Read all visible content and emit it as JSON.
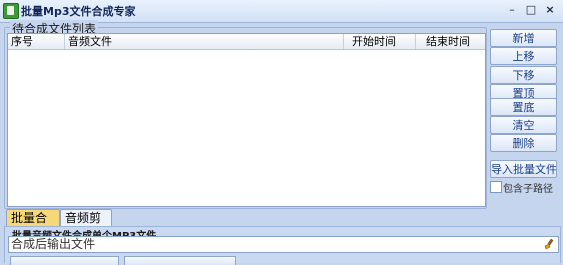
{
  "window": {
    "title": "批量Mp3文件合成专家",
    "controls": {
      "minimize": "–",
      "maximize": "□",
      "close": "×"
    }
  },
  "file_list": {
    "group_title": "待合成文件列表",
    "columns": [
      "序号",
      "音频文件",
      "开始时间",
      "结束时间"
    ],
    "rows": []
  },
  "side_buttons": [
    "新增",
    "上移",
    "下移",
    "置顶",
    "置底",
    "清空",
    "删除"
  ],
  "import_button": "导入批量文件",
  "include_subfolders": {
    "label": "包含子路径",
    "checked": false
  },
  "tabs": [
    {
      "label": "批量合成",
      "active": true
    },
    {
      "label": "音频剪切",
      "active": false
    }
  ],
  "merge_panel": {
    "title": "批量音频文件合成单个MP3文件",
    "output_label": "合成后输出文件",
    "output_value": "",
    "browse_icon": "brush-icon"
  }
}
